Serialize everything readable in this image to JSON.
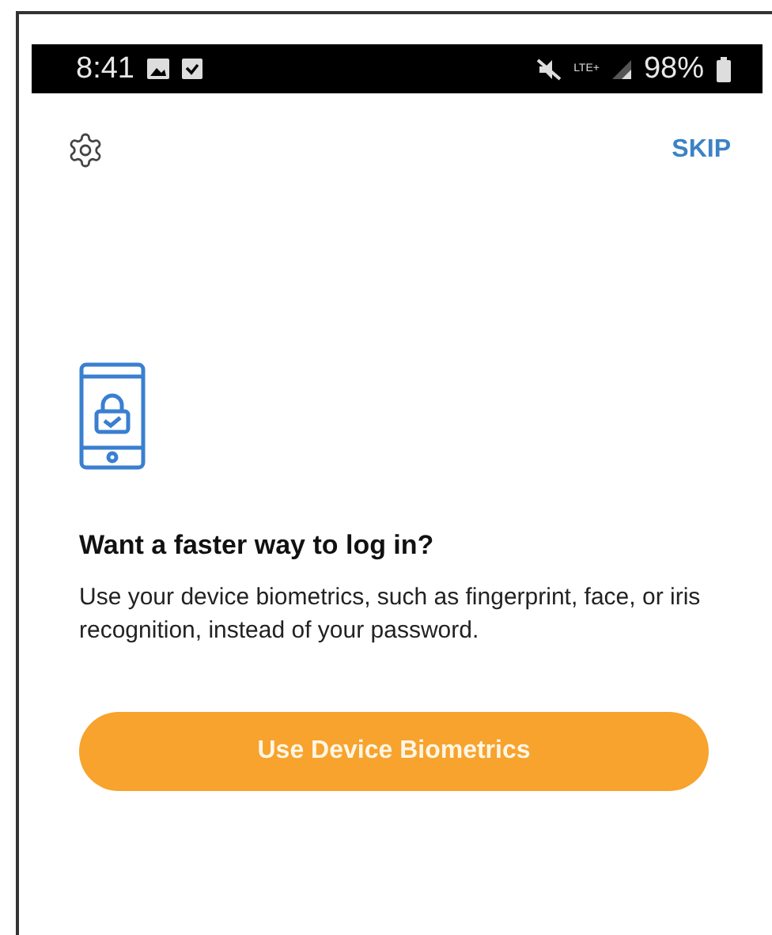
{
  "status_bar": {
    "time": "8:41",
    "network": "LTE+",
    "battery": "98%"
  },
  "top_bar": {
    "skip": "SKIP"
  },
  "prompt": {
    "title": "Want a faster way to log in?",
    "body": "Use your device biometrics, such as fingerprint, face, or iris recognition, instead of your password."
  },
  "button": {
    "label": "Use Device Biometrics"
  }
}
